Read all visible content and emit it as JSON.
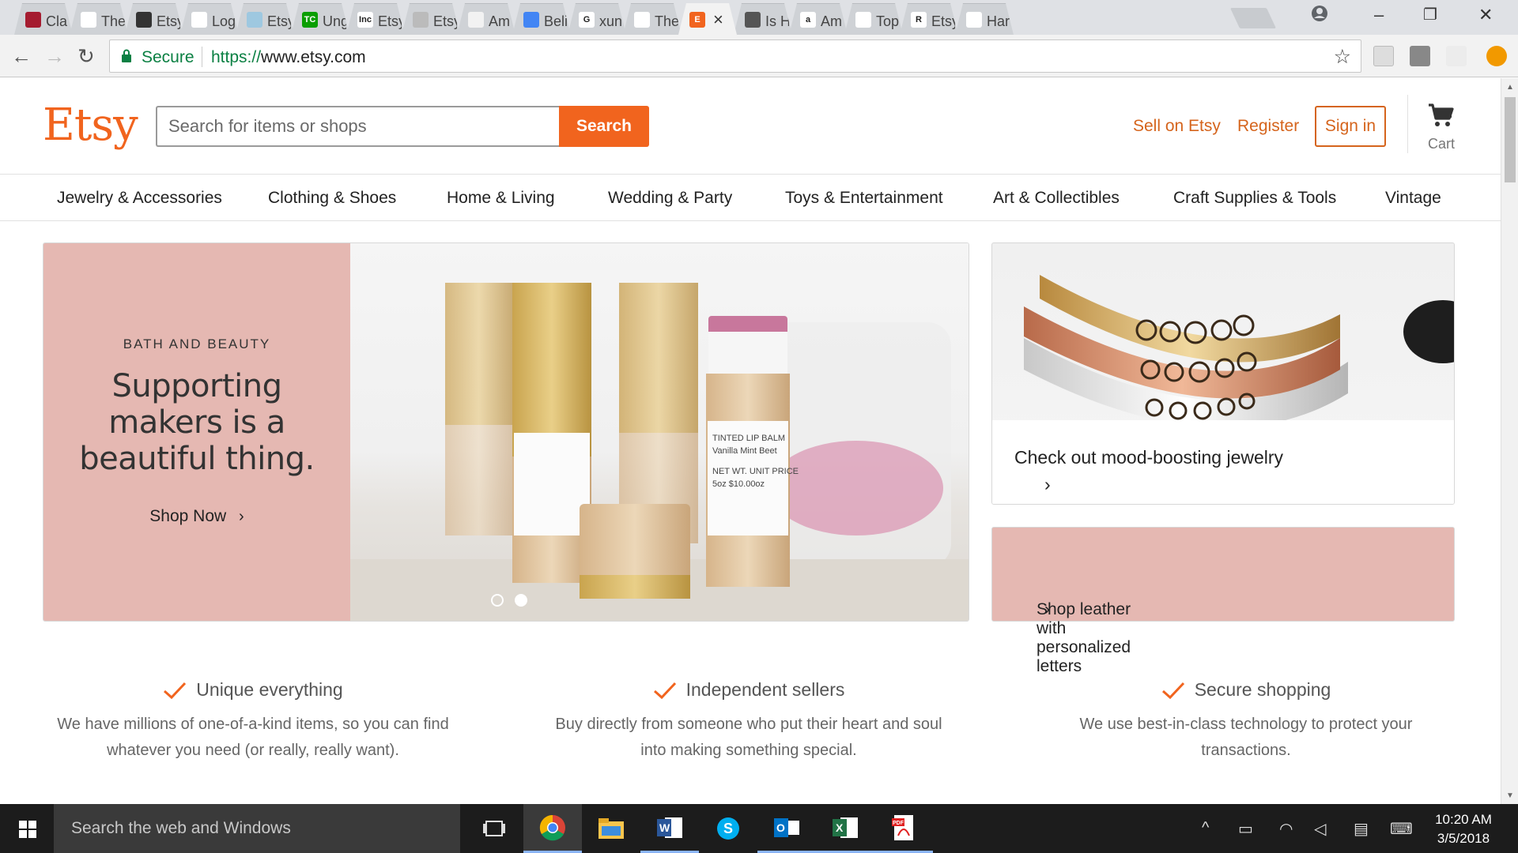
{
  "browser": {
    "tabs": [
      {
        "title": "Cla",
        "fav_color": "#a51c30",
        "fav_char": ""
      },
      {
        "title": "The",
        "fav_color": "#ffffff",
        "fav_char": ""
      },
      {
        "title": "Etsy",
        "fav_color": "#333333",
        "fav_char": ""
      },
      {
        "title": "Log",
        "fav_color": "#ffffff",
        "fav_char": ""
      },
      {
        "title": "Etsy",
        "fav_color": "#9ec8e0",
        "fav_char": ""
      },
      {
        "title": "Ung",
        "fav_color": "#0a9e01",
        "fav_char": "TC"
      },
      {
        "title": "Etsy",
        "fav_color": "#ffffff",
        "fav_char": "Inc"
      },
      {
        "title": "Etsy",
        "fav_color": "#bbbbbb",
        "fav_char": ""
      },
      {
        "title": "Am",
        "fav_color": "#f2f2f2",
        "fav_char": ""
      },
      {
        "title": "Beli",
        "fav_color": "#4285f4",
        "fav_char": ""
      },
      {
        "title": "xun",
        "fav_color": "#ffffff",
        "fav_char": "G"
      },
      {
        "title": "The",
        "fav_color": "#ffffff",
        "fav_char": ""
      },
      {
        "title": "",
        "fav_color": "#f1641e",
        "fav_char": "E"
      },
      {
        "title": "Is H",
        "fav_color": "#555555",
        "fav_char": ""
      },
      {
        "title": "Am",
        "fav_color": "#ffffff",
        "fav_char": "a"
      },
      {
        "title": "Top",
        "fav_color": "#ffffff",
        "fav_char": ""
      },
      {
        "title": "Etsy",
        "fav_color": "#ffffff",
        "fav_char": "R"
      },
      {
        "title": "Har",
        "fav_color": "#ffffff",
        "fav_char": ""
      }
    ],
    "secure_label": "Secure",
    "url_scheme": "https://",
    "url_host": "www.etsy.com"
  },
  "header": {
    "logo": "Etsy",
    "search_placeholder": "Search for items or shops",
    "search_button": "Search",
    "sell_link": "Sell on Etsy",
    "register_link": "Register",
    "signin_button": "Sign in",
    "cart_label": "Cart"
  },
  "categories": [
    "Jewelry & Accessories",
    "Clothing & Shoes",
    "Home & Living",
    "Wedding & Party",
    "Toys & Entertainment",
    "Art & Collectibles",
    "Craft Supplies & Tools",
    "Vintage"
  ],
  "hero": {
    "eyebrow": "BATH AND BEAUTY",
    "headline": "Supporting makers is a beautiful thing.",
    "cta": "Shop Now",
    "product_label_lines": [
      "TINTED LIP BALM",
      "Vanilla Mint Beet",
      "NET WT.  UNIT PRICE",
      "5oz       $10.00oz"
    ],
    "slides": 2,
    "active_slide": 2,
    "bg_color": "#e5b8b2"
  },
  "promos": {
    "jewelry": "Check out mood-boosting jewelry",
    "leather": "Shop leather with personalized letters"
  },
  "value_props": [
    {
      "title": "Unique everything",
      "desc": "We have millions of one-of-a-kind items, so you can find whatever you need (or really, really want)."
    },
    {
      "title": "Independent sellers",
      "desc": "Buy directly from someone who put their heart and soul into making something special."
    },
    {
      "title": "Secure shopping",
      "desc": "We use best-in-class technology to protect your transactions."
    }
  ],
  "taskbar": {
    "search_placeholder": "Search the web and Windows",
    "time": "10:20 AM",
    "date": "3/5/2018"
  },
  "colors": {
    "etsy_orange": "#f1641e",
    "link_orange": "#d5641c",
    "pink": "#e5b8b2"
  }
}
